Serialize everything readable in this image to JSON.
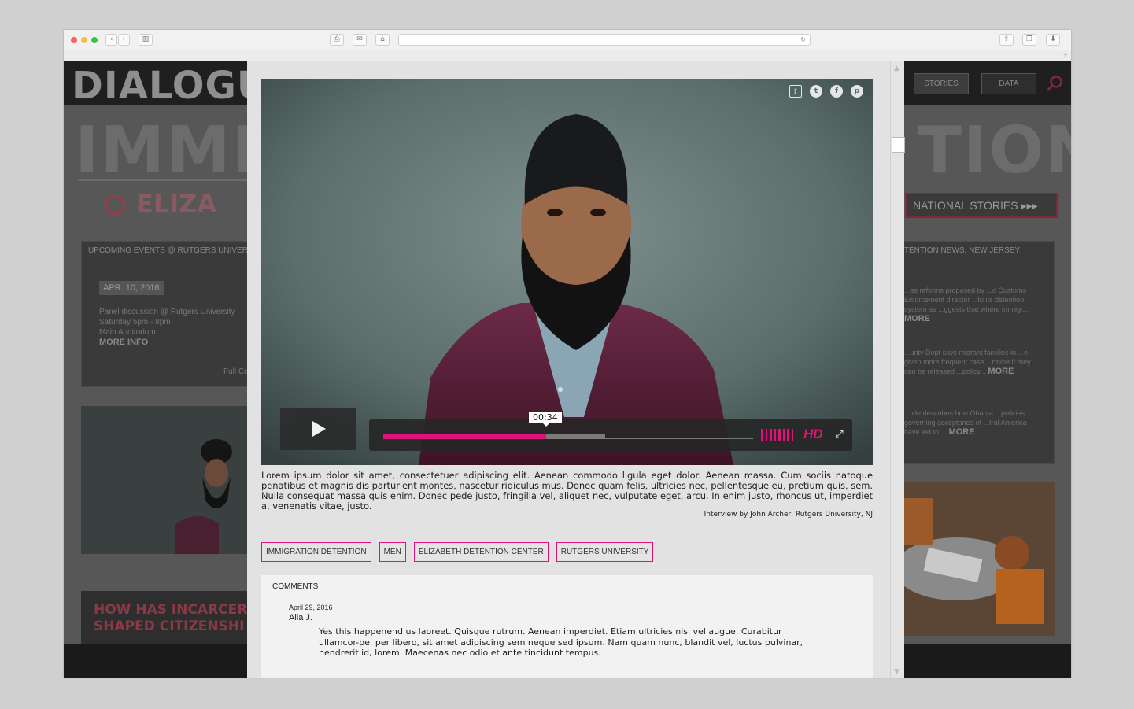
{
  "browser": {
    "nav_back": "‹",
    "nav_forward": "›",
    "sidebar_icon": "sidebar-icon",
    "print_icon": "print-icon",
    "mail_icon": "mail-icon",
    "home_icon": "home-icon",
    "reload_icon": "reload-icon",
    "share_icon": "share-icon",
    "tabs_icon": "tabs-icon",
    "download_icon": "download-icon",
    "new_tab": "+"
  },
  "site": {
    "title": "DIALOGUES ON INCARCERATION",
    "nav": {
      "stories": "STORIES",
      "data": "DATA"
    },
    "big_word_left": "IMMI",
    "big_word_right": "TION",
    "location": "ELIZA",
    "national_stories": "NATIONAL STORIES ▸▸▸",
    "events": {
      "heading": "UPCOMING EVENTS @ RUTGERS UNIVERSITY",
      "date": "APR. 10, 2016",
      "line1": "Panel discussion @ Rutgers University",
      "line2": "Saturday 5pm - 8pm",
      "line3": "Main Auditorium",
      "more": "MORE INFO",
      "full_calendar": "Full Ca..."
    },
    "news": {
      "heading": "DETENTION NEWS, NEW JERSEY",
      "item1": "...as reforms proposed by ...d Customs Enforcement director ...to its detention system as ...ggests that where immigr...",
      "item2": "...unty Dept says migrant families in ...e given more frequent case ...rmine if they can be released ...policy...",
      "item3": "...icle describes how Obama ...policies governing acceptance of ...tral America have led to ...",
      "more": "MORE"
    },
    "question": "HOW HAS INCARCER... SHAPED CITIZENSHI...",
    "question_line1": "HOW HAS INCARCER",
    "question_line2": "SHAPED CITIZENSHI"
  },
  "modal": {
    "share_icons": [
      "share-icon",
      "twitter-icon",
      "facebook-icon",
      "pinterest-icon"
    ],
    "video": {
      "current_time": "00:34",
      "played_fraction": 0.44,
      "buffered_fraction": 0.6,
      "hd_label": "HD",
      "accent": "#e0127a"
    },
    "caption": "Lorem ipsum dolor sit amet, consectetuer adipiscing elit. Aenean commodo ligula eget dolor. Aenean massa. Cum sociis natoque penatibus et magnis dis parturient montes, nascetur ridiculus mus. Donec quam felis, ultricies nec, pellentesque eu, pretium quis, sem. Nulla consequat massa quis enim. Donec pede justo, fringilla vel, aliquet nec, vulputate eget, arcu. In enim justo, rhoncus ut, imperdiet a, venenatis vitae, justo.",
    "credit": "Interview by John Archer, Rutgers University, NJ",
    "tags": [
      "IMMIGRATION DETENTION",
      "MEN",
      "ELIZABETH DETENTION CENTER",
      "RUTGERS UNIVERSITY"
    ],
    "comments": {
      "heading": "COMMENTS",
      "date": "April 29, 2016",
      "author": "Aila J.",
      "text": "Yes this happenend us laoreet. Quisque rutrum. Aenean imperdiet. Etiam ultricies nisi vel augue. Curabitur ullamcor-pe. per libero, sit amet adipiscing sem neque sed ipsum. Nam quam nunc, blandit vel, luctus pulvinar, hendrerit id, lorem. Maecenas nec odio et ante tincidunt tempus."
    }
  }
}
